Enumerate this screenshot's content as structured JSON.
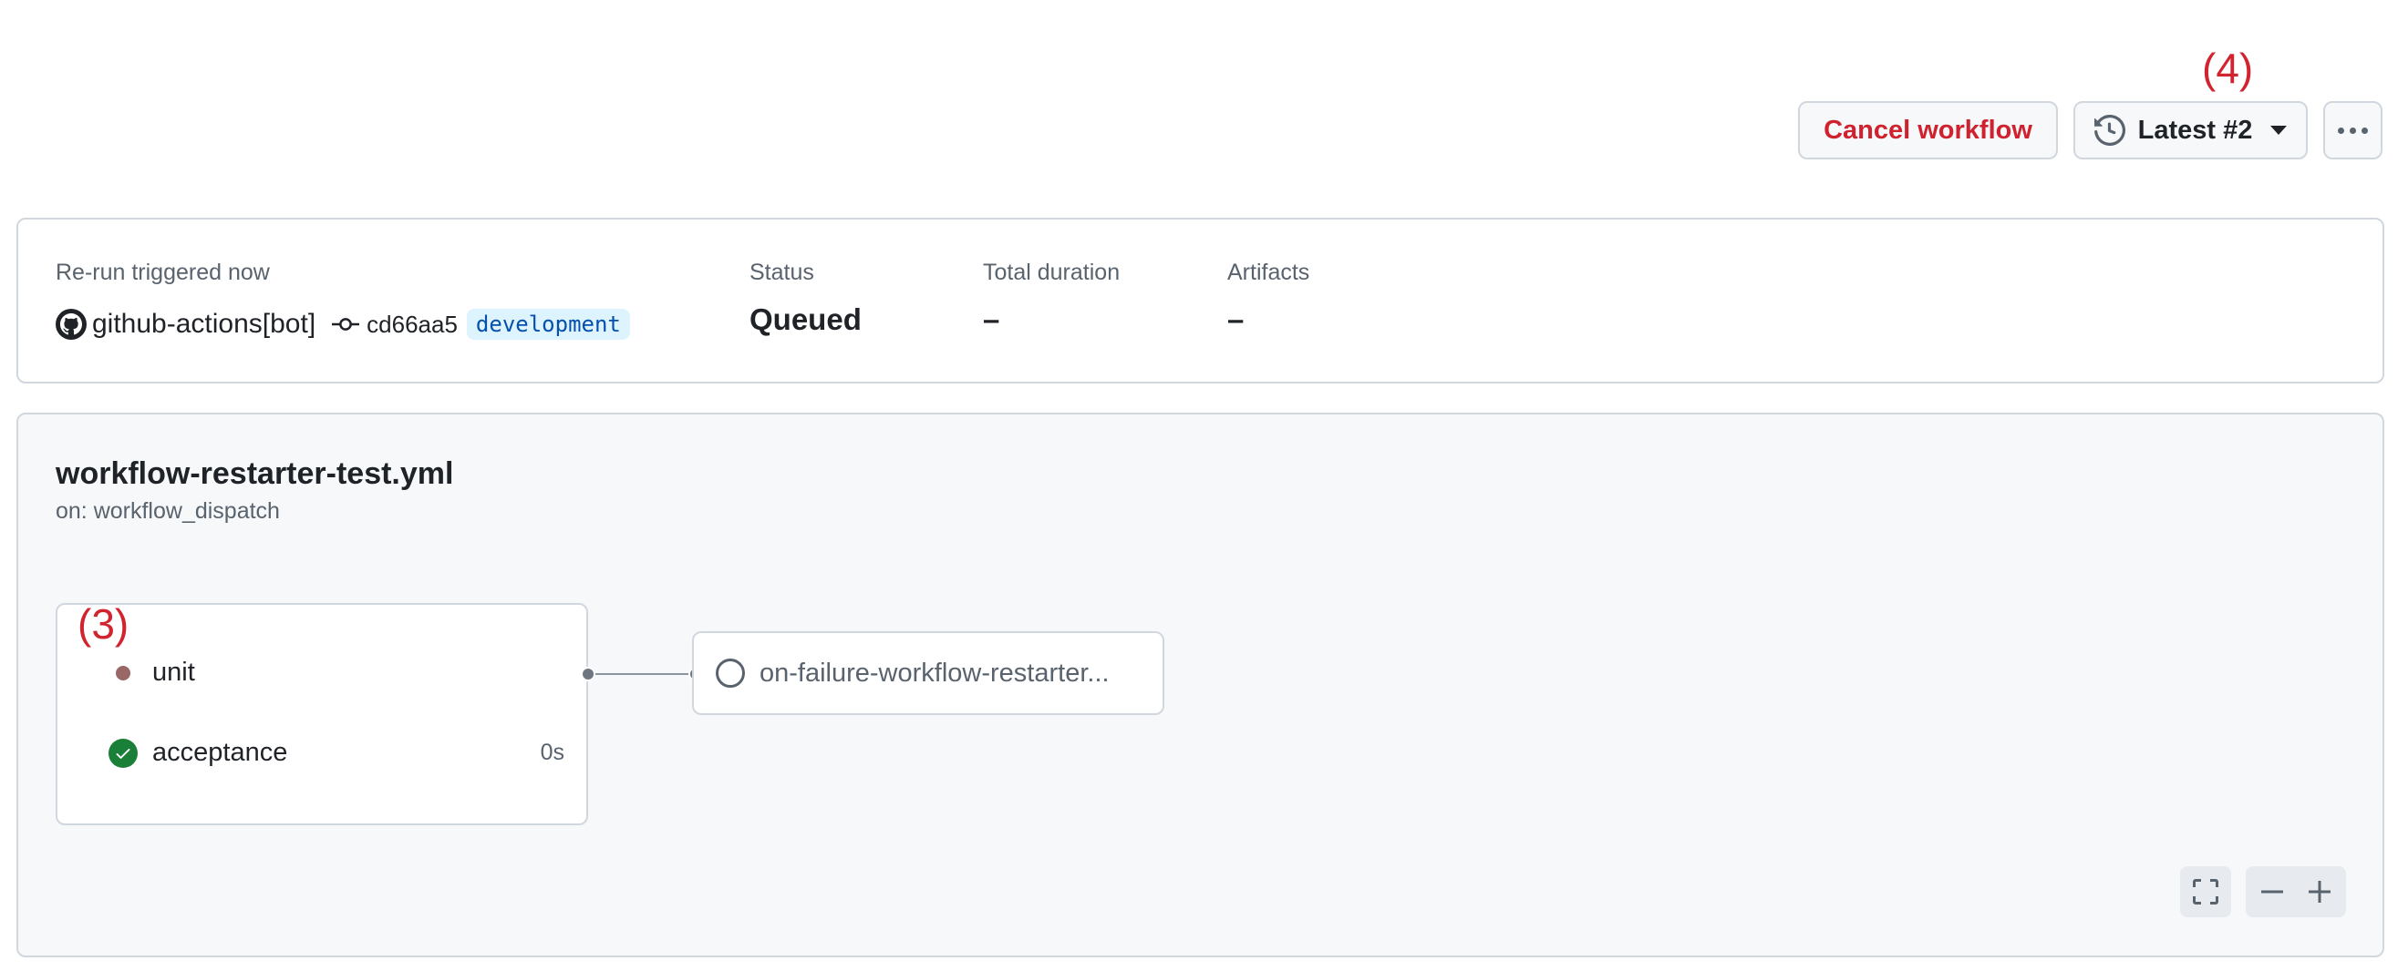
{
  "annotations": {
    "top_right": "(4)",
    "job_group": "(3)"
  },
  "toolbar": {
    "cancel_label": "Cancel workflow",
    "latest_label": "Latest #2",
    "more_icon": "kebab-horizontal-icon"
  },
  "summary": {
    "trigger_label": "Re-run triggered now",
    "actor": "github-actions[bot]",
    "commit": "cd66aa5",
    "branch": "development",
    "status_label": "Status",
    "status_value": "Queued",
    "duration_label": "Total duration",
    "duration_value": "–",
    "artifacts_label": "Artifacts",
    "artifacts_value": "–"
  },
  "workflow": {
    "name": "workflow-restarter-test.yml",
    "trigger": "on: workflow_dispatch",
    "jobs": [
      {
        "name": "unit",
        "status": "queued",
        "duration": ""
      },
      {
        "name": "acceptance",
        "status": "success",
        "duration": "0s"
      }
    ],
    "next_job": {
      "name": "on-failure-workflow-restarter...",
      "status": "pending"
    }
  },
  "colors": {
    "danger": "#cf222e",
    "success": "#1a7f37",
    "branch_bg": "#ddf4ff",
    "branch_fg": "#0550ae",
    "annotation": "#d1242f"
  }
}
